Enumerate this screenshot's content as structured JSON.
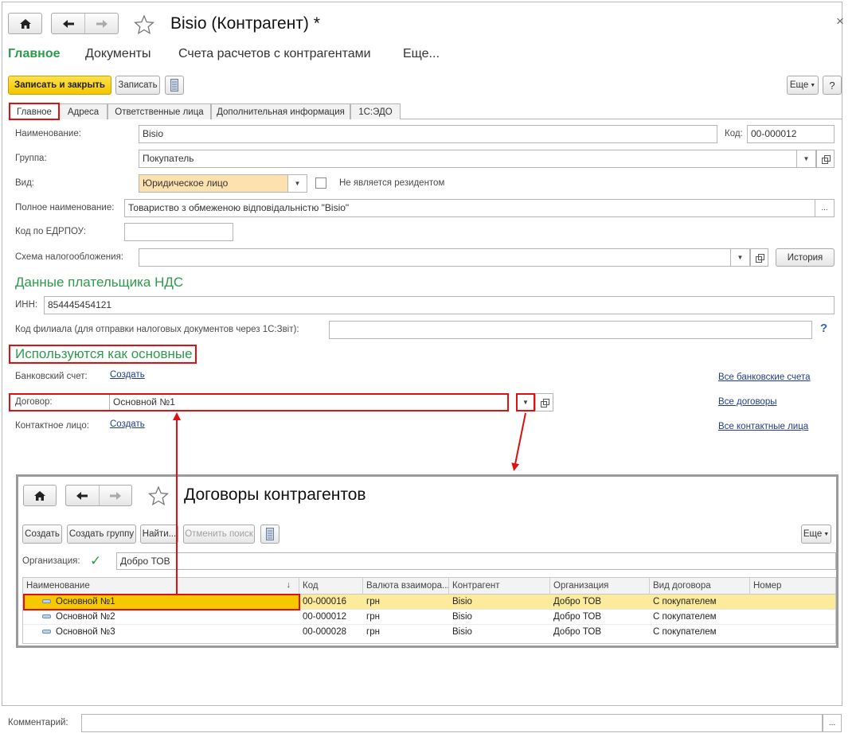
{
  "window": {
    "title": "Bisio (Контрагент) *",
    "close": "×"
  },
  "menu": {
    "main": "Главное",
    "documents": "Документы",
    "accounts": "Счета расчетов с контрагентами",
    "more": "Еще..."
  },
  "toolbar": {
    "save_close": "Записать и закрыть",
    "save": "Записать",
    "more": "Еще",
    "help": "?"
  },
  "tabs": [
    "Главное",
    "Адреса",
    "Ответственные лица",
    "Дополнительная информация",
    "1С:ЭДО"
  ],
  "form": {
    "name_label": "Наименование:",
    "name_value": "Bisio",
    "code_label": "Код:",
    "code_value": "00-000012",
    "group_label": "Группа:",
    "group_value": "Покупатель",
    "kind_label": "Вид:",
    "kind_value": "Юридическое лицо",
    "nonresident_label": "Не является резидентом",
    "fullname_label": "Полное наименование:",
    "fullname_value": "Товариство з обмеженою відповідальністю \"Bisio\"",
    "edrpou_label": "Код по ЕДРПОУ:",
    "edrpou_value": "",
    "tax_label": "Схема налогообложения:",
    "tax_value": "",
    "history": "История",
    "vat_heading": "Данные плательщика НДС",
    "inn_label": "ИНН:",
    "inn_value": "854445454121",
    "branch_label": "Код филиала (для отправки налоговых документов через 1С:Звіт):",
    "branch_value": "",
    "branch_help": "?",
    "main_heading": "Используются как основные",
    "bank_label": "Банковский счет:",
    "bank_create": "Создать",
    "all_banks": "Все банковские счета",
    "contract_label": "Договор:",
    "contract_value": "Основной №1",
    "all_contracts": "Все договоры",
    "contact_label": "Контактное лицо:",
    "contact_create": "Создать",
    "all_contacts": "Все контактные лица",
    "comment_label": "Комментарий:",
    "comment_value": "",
    "ellipsis": "..."
  },
  "popup": {
    "title": "Договоры контрагентов",
    "create": "Создать",
    "create_group": "Создать группу",
    "find": "Найти...",
    "cancel_search": "Отменить поиск",
    "more": "Еще",
    "org_label": "Организация:",
    "org_value": "Добро ТОВ",
    "columns": [
      "Наименование",
      "Код",
      "Валюта взаимора...",
      "Контрагент",
      "Организация",
      "Вид договора",
      "Номер"
    ],
    "rows": [
      [
        "Основной №1",
        "00-000016",
        "грн",
        "Bisio",
        "Добро ТОВ",
        "С покупателем",
        ""
      ],
      [
        "Основной №2",
        "00-000012",
        "грн",
        "Bisio",
        "Добро ТОВ",
        "С покупателем",
        ""
      ],
      [
        "Основной №3",
        "00-000028",
        "грн",
        "Bisio",
        "Добро ТОВ",
        "С покупателем",
        ""
      ]
    ]
  },
  "colors": {
    "accent_green": "#2e9a4b",
    "highlight_yellow": "#fbeb9a",
    "annotation_red": "#e01010"
  }
}
